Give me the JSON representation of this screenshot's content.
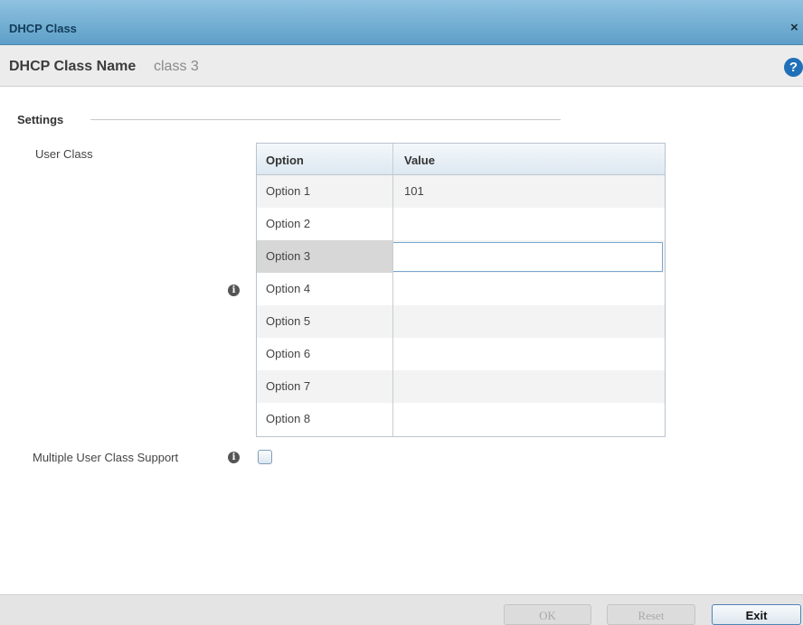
{
  "dialog": {
    "title": "DHCP Class",
    "close_glyph": "×",
    "name_label": "DHCP Class Name",
    "name_value": "class 3",
    "help_glyph": "?"
  },
  "settings": {
    "heading": "Settings",
    "user_class_label": "User Class",
    "info_glyph": "i",
    "table": {
      "columns": [
        "Option",
        "Value"
      ],
      "rows": [
        {
          "option": "Option 1",
          "value": "101"
        },
        {
          "option": "Option 2",
          "value": ""
        },
        {
          "option": "Option 3",
          "value": ""
        },
        {
          "option": "Option 4",
          "value": ""
        },
        {
          "option": "Option 5",
          "value": ""
        },
        {
          "option": "Option 6",
          "value": ""
        },
        {
          "option": "Option 7",
          "value": ""
        },
        {
          "option": "Option 8",
          "value": ""
        }
      ]
    },
    "multiple_user_class_label": "Multiple User Class Support",
    "multiple_user_class_checked": false
  },
  "footer": {
    "ok_label": "OK",
    "reset_label": "Reset",
    "exit_label": "Exit"
  }
}
